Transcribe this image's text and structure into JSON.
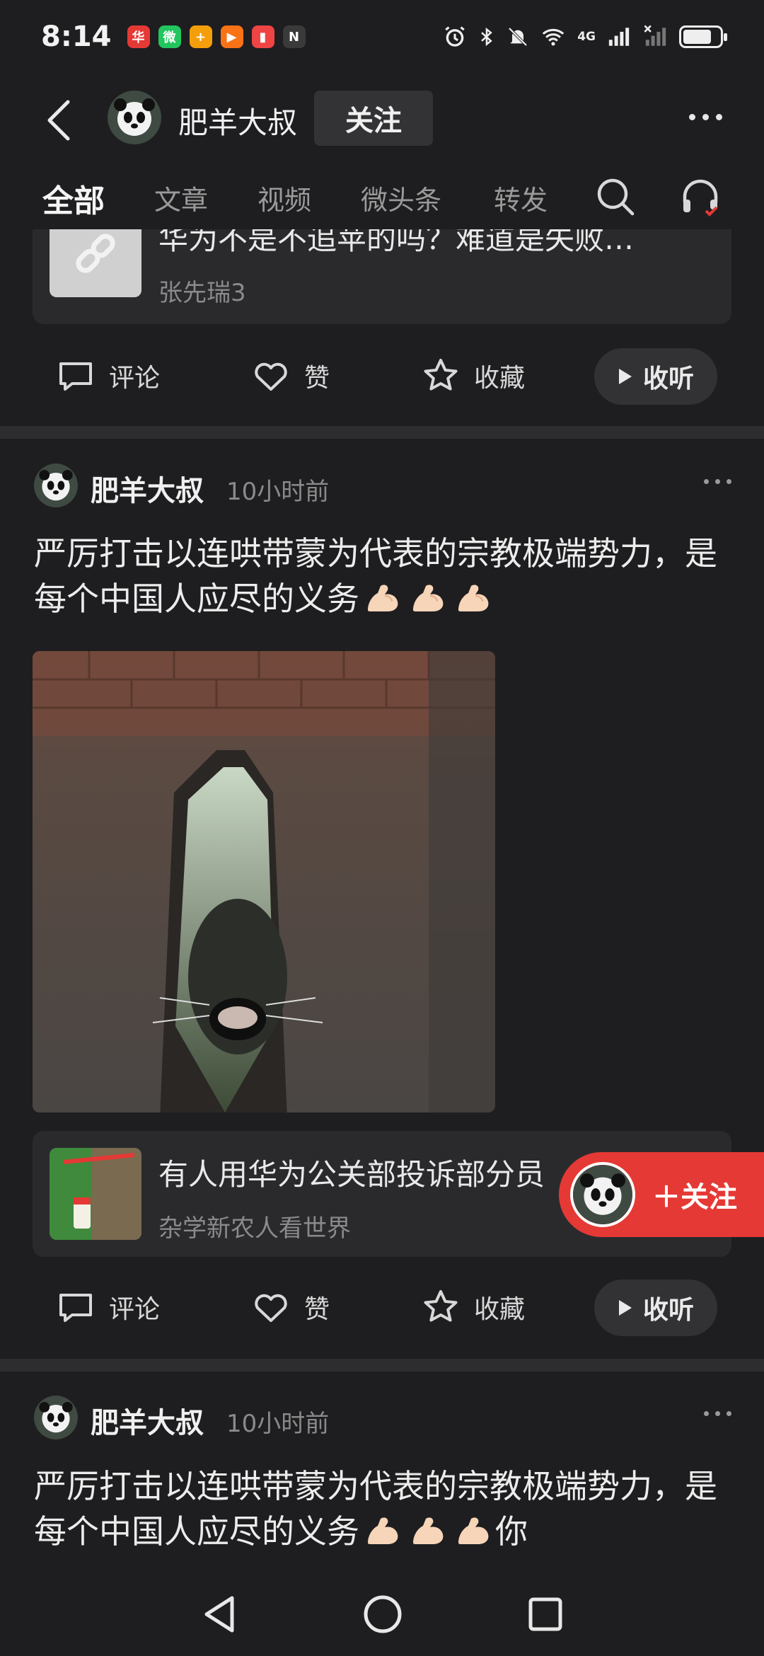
{
  "status_bar": {
    "time": "8:14",
    "apps": [
      {
        "name": "huawei-icon",
        "color": "#e53935",
        "glyph": "华"
      },
      {
        "name": "wechat-icon",
        "color": "#22c55e",
        "glyph": "微"
      },
      {
        "name": "colorful-app-icon",
        "color": "#f59e0b",
        "glyph": "+"
      },
      {
        "name": "video-app-icon",
        "color": "#f97316",
        "glyph": "▶"
      },
      {
        "name": "red-app-icon",
        "color": "#ef4444",
        "glyph": "▮"
      },
      {
        "name": "nfc-icon",
        "color": "#3a3a3a",
        "glyph": "N"
      }
    ],
    "network": "4G"
  },
  "header": {
    "profile_name": "肥羊大叔",
    "follow_label": "关注"
  },
  "tabs": [
    {
      "label": "全部",
      "active": true
    },
    {
      "label": "文章",
      "active": false
    },
    {
      "label": "视频",
      "active": false
    },
    {
      "label": "微头条",
      "active": false
    },
    {
      "label": "转发",
      "active": false
    }
  ],
  "post1": {
    "link_title": "华为不是不追苹的吗？难道是失败…",
    "link_source": "张先瑞3",
    "actions": {
      "comment": "评论",
      "like": "赞",
      "collect": "收藏",
      "listen": "收听"
    }
  },
  "post2": {
    "author": "肥羊大叔",
    "time": "10小时前",
    "text": "严厉打击以连哄带蒙为代表的宗教极端势力，是每个中国人应尽的义务",
    "link_title": "有人用华为公关部投诉部分员",
    "link_source": "杂学新农人看世界",
    "actions": {
      "comment": "评论",
      "like": "赞",
      "collect": "收藏",
      "listen": "收听"
    }
  },
  "post3": {
    "author": "肥羊大叔",
    "time": "10小时前",
    "text": "严厉打击以连哄带蒙为代表的宗教极端势力，是每个中国人应尽的义务",
    "text_suffix": "你"
  },
  "floating_follow": {
    "label": "＋关注"
  },
  "colors": {
    "accent_red": "#e53935",
    "background": "#1e1e20",
    "card": "#2a2a2d"
  }
}
